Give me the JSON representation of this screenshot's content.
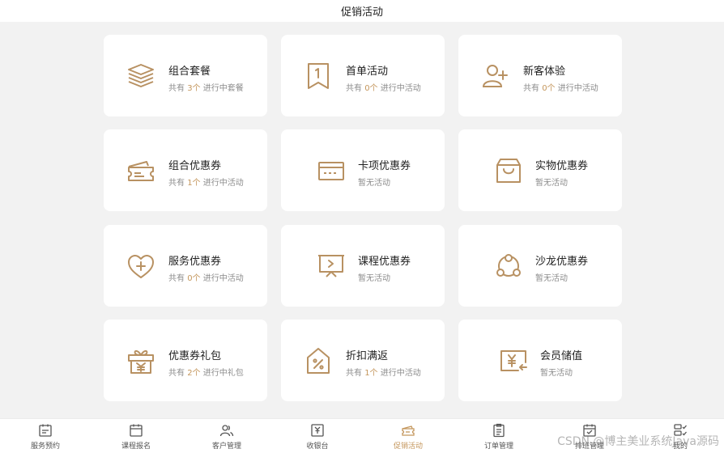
{
  "header": {
    "title": "促销活动"
  },
  "cards": [
    {
      "name": "组合套餐",
      "sub_prefix": "共有 ",
      "count": "3个",
      "sub_suffix": " 进行中套餐",
      "icon": "layers-icon"
    },
    {
      "name": "首单活动",
      "sub_prefix": "共有 ",
      "count": "0个",
      "sub_suffix": " 进行中活动",
      "icon": "first-order-icon"
    },
    {
      "name": "新客体验",
      "sub_prefix": "共有 ",
      "count": "0个",
      "sub_suffix": " 进行中活动",
      "icon": "add-user-icon"
    },
    {
      "name": "组合优惠券",
      "sub_prefix": "共有 ",
      "count": "1个",
      "sub_suffix": " 进行中活动",
      "icon": "ticket-icon"
    },
    {
      "name": "卡项优惠券",
      "sub_prefix": "暂无活动",
      "count": "",
      "sub_suffix": "",
      "icon": "card-icon"
    },
    {
      "name": "实物优惠券",
      "sub_prefix": "暂无活动",
      "count": "",
      "sub_suffix": "",
      "icon": "bag-icon"
    },
    {
      "name": "服务优惠券",
      "sub_prefix": "共有 ",
      "count": "0个",
      "sub_suffix": " 进行中活动",
      "icon": "heart-plus-icon"
    },
    {
      "name": "课程优惠券",
      "sub_prefix": "暂无活动",
      "count": "",
      "sub_suffix": "",
      "icon": "presentation-icon"
    },
    {
      "name": "沙龙优惠券",
      "sub_prefix": "暂无活动",
      "count": "",
      "sub_suffix": "",
      "icon": "salon-icon"
    },
    {
      "name": "优惠券礼包",
      "sub_prefix": "共有 ",
      "count": "2个",
      "sub_suffix": " 进行中礼包",
      "icon": "gift-icon"
    },
    {
      "name": "折扣满返",
      "sub_prefix": "共有 ",
      "count": "1个",
      "sub_suffix": " 进行中活动",
      "icon": "discount-tag-icon"
    },
    {
      "name": "会员储值",
      "sub_prefix": "暂无活动",
      "count": "",
      "sub_suffix": "",
      "icon": "stored-value-icon"
    }
  ],
  "tabs": [
    {
      "label": "服务预约",
      "icon": "calendar-list-icon",
      "active": false
    },
    {
      "label": "课程报名",
      "icon": "calendar-icon",
      "active": false
    },
    {
      "label": "客户管理",
      "icon": "users-icon",
      "active": false
    },
    {
      "label": "收银台",
      "icon": "cashier-icon",
      "active": false
    },
    {
      "label": "促销活动",
      "icon": "ticket-icon",
      "active": true
    },
    {
      "label": "订单管理",
      "icon": "clipboard-icon",
      "active": false
    },
    {
      "label": "排班管理",
      "icon": "schedule-icon",
      "active": false
    },
    {
      "label": "我的",
      "icon": "profile-list-icon",
      "active": false
    }
  ],
  "watermark": "CSDN @博主美业系统Java源码",
  "colors": {
    "accent": "#c4965c",
    "icon": "#b89162",
    "background": "#f2f2f2"
  }
}
